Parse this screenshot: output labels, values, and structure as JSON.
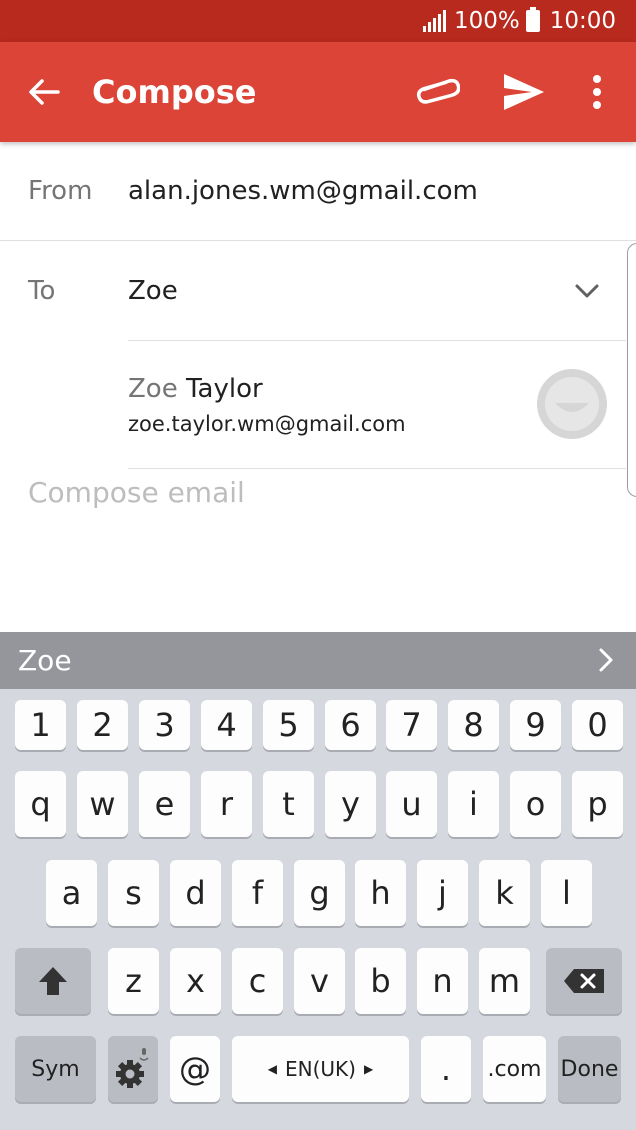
{
  "status_bar": {
    "battery": "100%",
    "time": "10:00"
  },
  "app_bar": {
    "title": "Compose",
    "back_icon": "arrow-left-icon",
    "attach_icon": "paperclip-icon",
    "send_icon": "send-icon",
    "more_icon": "more-vert-icon"
  },
  "from": {
    "label": "From",
    "value": "alan.jones.wm@gmail.com"
  },
  "to": {
    "label": "To",
    "value": "Zoe"
  },
  "suggestion": {
    "name_typed": "Zoe",
    "name_rest": " Taylor",
    "email": "zoe.taylor.wm@gmail.com"
  },
  "compose": {
    "placeholder": "Compose email"
  },
  "prediction": {
    "word": "Zoe"
  },
  "keyboard": {
    "numbers": [
      "1",
      "2",
      "3",
      "4",
      "5",
      "6",
      "7",
      "8",
      "9",
      "0"
    ],
    "row1": [
      "q",
      "w",
      "e",
      "r",
      "t",
      "y",
      "u",
      "i",
      "o",
      "p"
    ],
    "row2": [
      "a",
      "s",
      "d",
      "f",
      "g",
      "h",
      "j",
      "k",
      "l"
    ],
    "row3": [
      "z",
      "x",
      "c",
      "v",
      "b",
      "n",
      "m"
    ],
    "sym": "Sym",
    "at": "@",
    "language": "EN(UK)",
    "period": ".",
    "dotcom": ".com",
    "done": "Done"
  },
  "colors": {
    "status_bar": "#b8291e",
    "app_bar": "#db4437",
    "prediction_bar": "#95969b",
    "keyboard_bg": "#d5d8de"
  }
}
